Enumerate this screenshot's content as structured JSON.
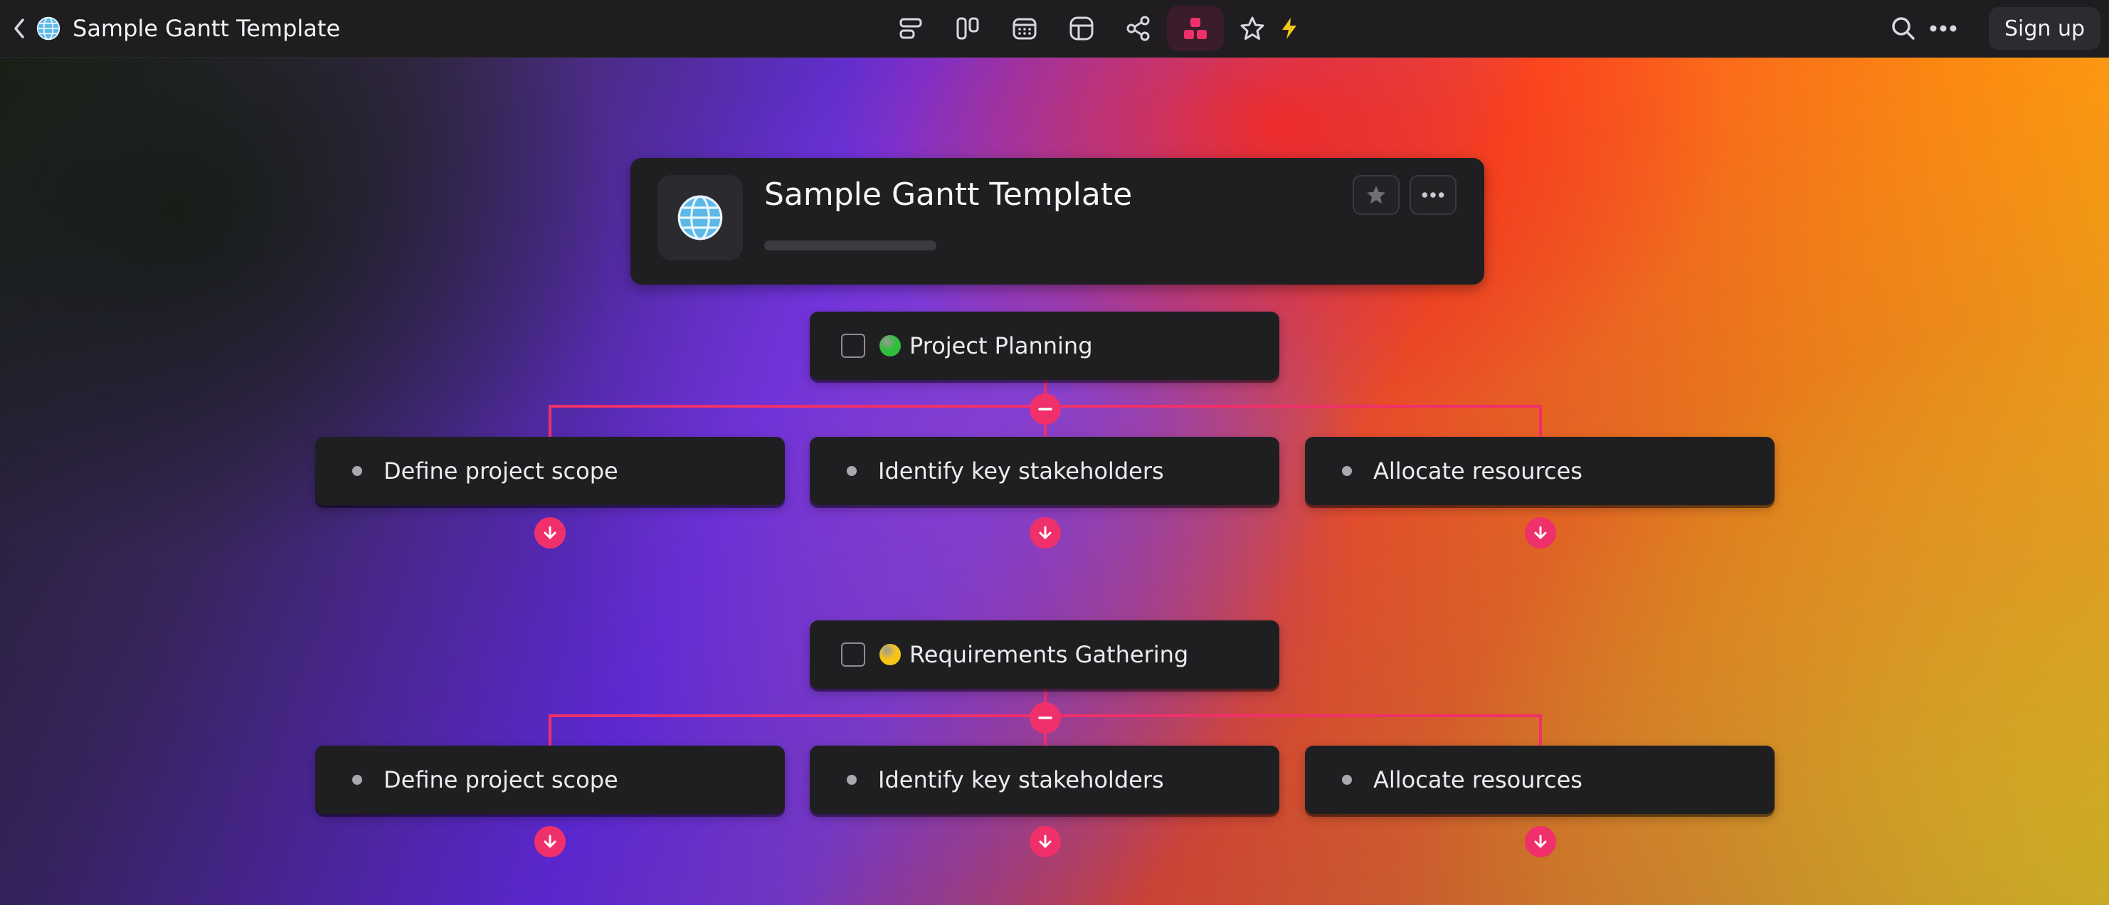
{
  "app": {
    "title": "Sample Gantt Template",
    "globe_icon": "globe-icon",
    "signup_label": "Sign up"
  },
  "toolbar": {
    "views": [
      {
        "icon": "list-view-icon"
      },
      {
        "icon": "board-view-icon"
      },
      {
        "icon": "calendar-view-icon"
      },
      {
        "icon": "table-view-icon"
      },
      {
        "icon": "graph-view-icon"
      },
      {
        "icon": "mindmap-view-icon",
        "active": true
      },
      {
        "icon": "star-icon"
      }
    ],
    "extra_icon": "bolt-icon"
  },
  "header_card": {
    "title": "Sample Gantt Template",
    "icon": "globe-icon"
  },
  "groups": [
    {
      "title": "Project Planning",
      "status_color": "#2fbf3a",
      "children": [
        {
          "label": "Define project scope"
        },
        {
          "label": "Identify key stakeholders"
        },
        {
          "label": "Allocate resources"
        }
      ]
    },
    {
      "title": "Requirements Gathering",
      "status_color": "#f5c518",
      "children": [
        {
          "label": "Define project scope"
        },
        {
          "label": "Identify key stakeholders"
        },
        {
          "label": "Allocate resources"
        }
      ]
    }
  ],
  "colors": {
    "accent": "#f0306a",
    "card": "#1f1f22",
    "topbar": "#1f1d20"
  }
}
